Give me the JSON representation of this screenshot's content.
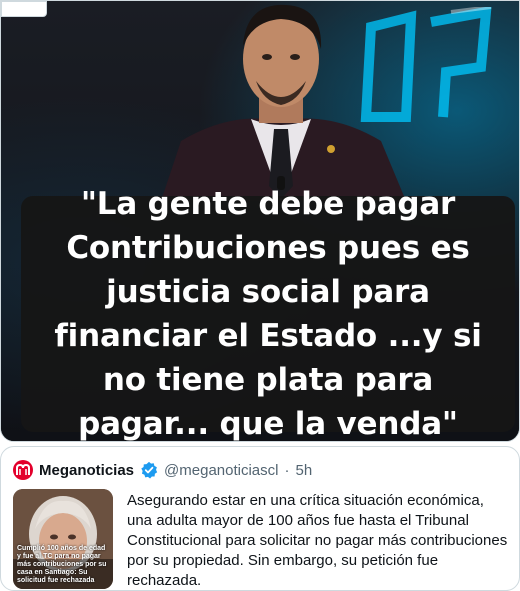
{
  "media": {
    "quote": "\"La gente debe pagar Contribuciones pues es justicia social para financiar el Estado ...y si no tiene plata para pagar... que la venda\""
  },
  "quoted_tweet": {
    "display_name": "Meganoticias",
    "handle": "@meganoticiascl",
    "separator": "·",
    "time": "5h",
    "text": "Asegurando estar en una crítica situación económica, una adulta mayor de 100 años fue hasta el Tribunal Constitucional para solicitar no pagar más contribuciones por su propiedad. Sin embargo, su petición fue rechazada.",
    "thumbnail_caption": "Cumplió 100 años de edad y fue al TC para no pagar más contribuciones por su casa en Santiago: Su solicitud fue rechazada",
    "avatar_color": "#e3002c",
    "verified_color": "#1d9bf0"
  }
}
